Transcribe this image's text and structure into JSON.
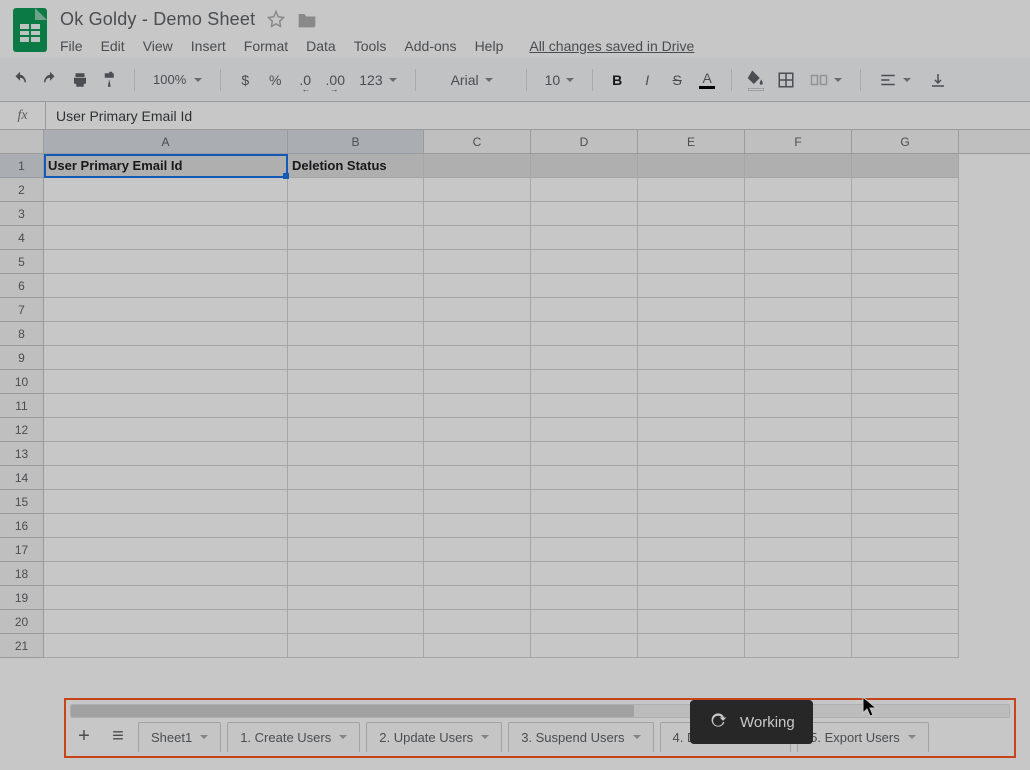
{
  "header": {
    "doc_title": "Ok Goldy - Demo Sheet",
    "save_status": "All changes saved in Drive",
    "menus": [
      "File",
      "Edit",
      "View",
      "Insert",
      "Format",
      "Data",
      "Tools",
      "Add-ons",
      "Help"
    ]
  },
  "toolbar": {
    "zoom": "100%",
    "currency": "$",
    "percent": "%",
    "dec_dec": ".0",
    "inc_dec": ".00",
    "num_format": "123",
    "font_name": "Arial",
    "font_size": "10",
    "bold": "B",
    "italic": "I",
    "strike": "S",
    "text_color": "A"
  },
  "formula_bar": {
    "fx_label": "fx",
    "value": "User Primary Email Id"
  },
  "columns": [
    "A",
    "B",
    "C",
    "D",
    "E",
    "F",
    "G"
  ],
  "rows": [
    "1",
    "2",
    "3",
    "4",
    "5",
    "6",
    "7",
    "8",
    "9",
    "10",
    "11",
    "12",
    "13",
    "14",
    "15",
    "16",
    "17",
    "18",
    "19",
    "20",
    "21"
  ],
  "cells": {
    "A1": "User Primary Email Id",
    "B1": "Deletion Status"
  },
  "sheet_tabs": [
    "Sheet1",
    "1. Create Users",
    "2. Update Users",
    "3. Suspend Users",
    "4. Delete Users",
    "5. Export Users"
  ],
  "toast": {
    "label": "Working"
  }
}
